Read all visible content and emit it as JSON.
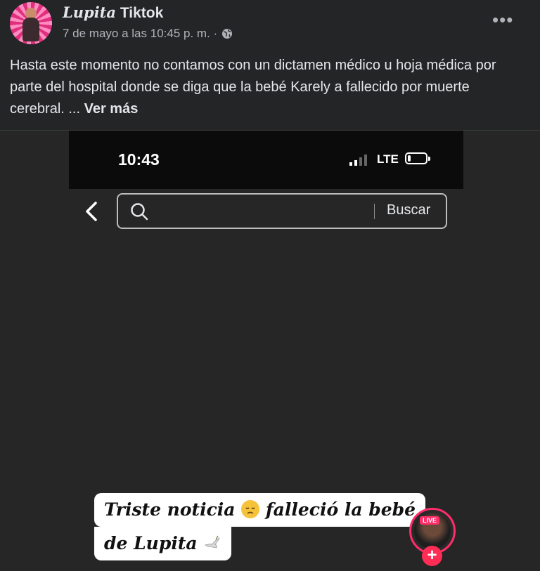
{
  "post": {
    "author_fancy": "Lupita",
    "author_rest": " Tiktok",
    "timestamp": "7 de mayo a las 10:45 p. m. ·",
    "more_label": "•••",
    "text": "Hasta este momento no contamos con un dictamen médico u hoja médica por parte del hospital donde se diga que la bebé Karely a fallecido por muerte cerebral. ... ",
    "see_more": "Ver más"
  },
  "phone": {
    "time": "10:43",
    "network": "LTE",
    "battery_level": 0.15,
    "signal_bars": 2
  },
  "search": {
    "placeholder": "",
    "button_label": "Buscar"
  },
  "caption": {
    "line1_a": "Triste noticia ",
    "line1_b": " falleció la bebé",
    "line2": "de Lupita "
  },
  "live": {
    "badge": "LIVE",
    "plus": "+"
  },
  "icons": [
    "back-icon",
    "search-icon",
    "globe-icon",
    "more-options-icon",
    "signal-icon",
    "battery-icon",
    "sad-face-emoji",
    "dove-emoji",
    "plus-icon"
  ],
  "colors": {
    "background": "#242526",
    "accent_live": "#ff2d6a"
  }
}
